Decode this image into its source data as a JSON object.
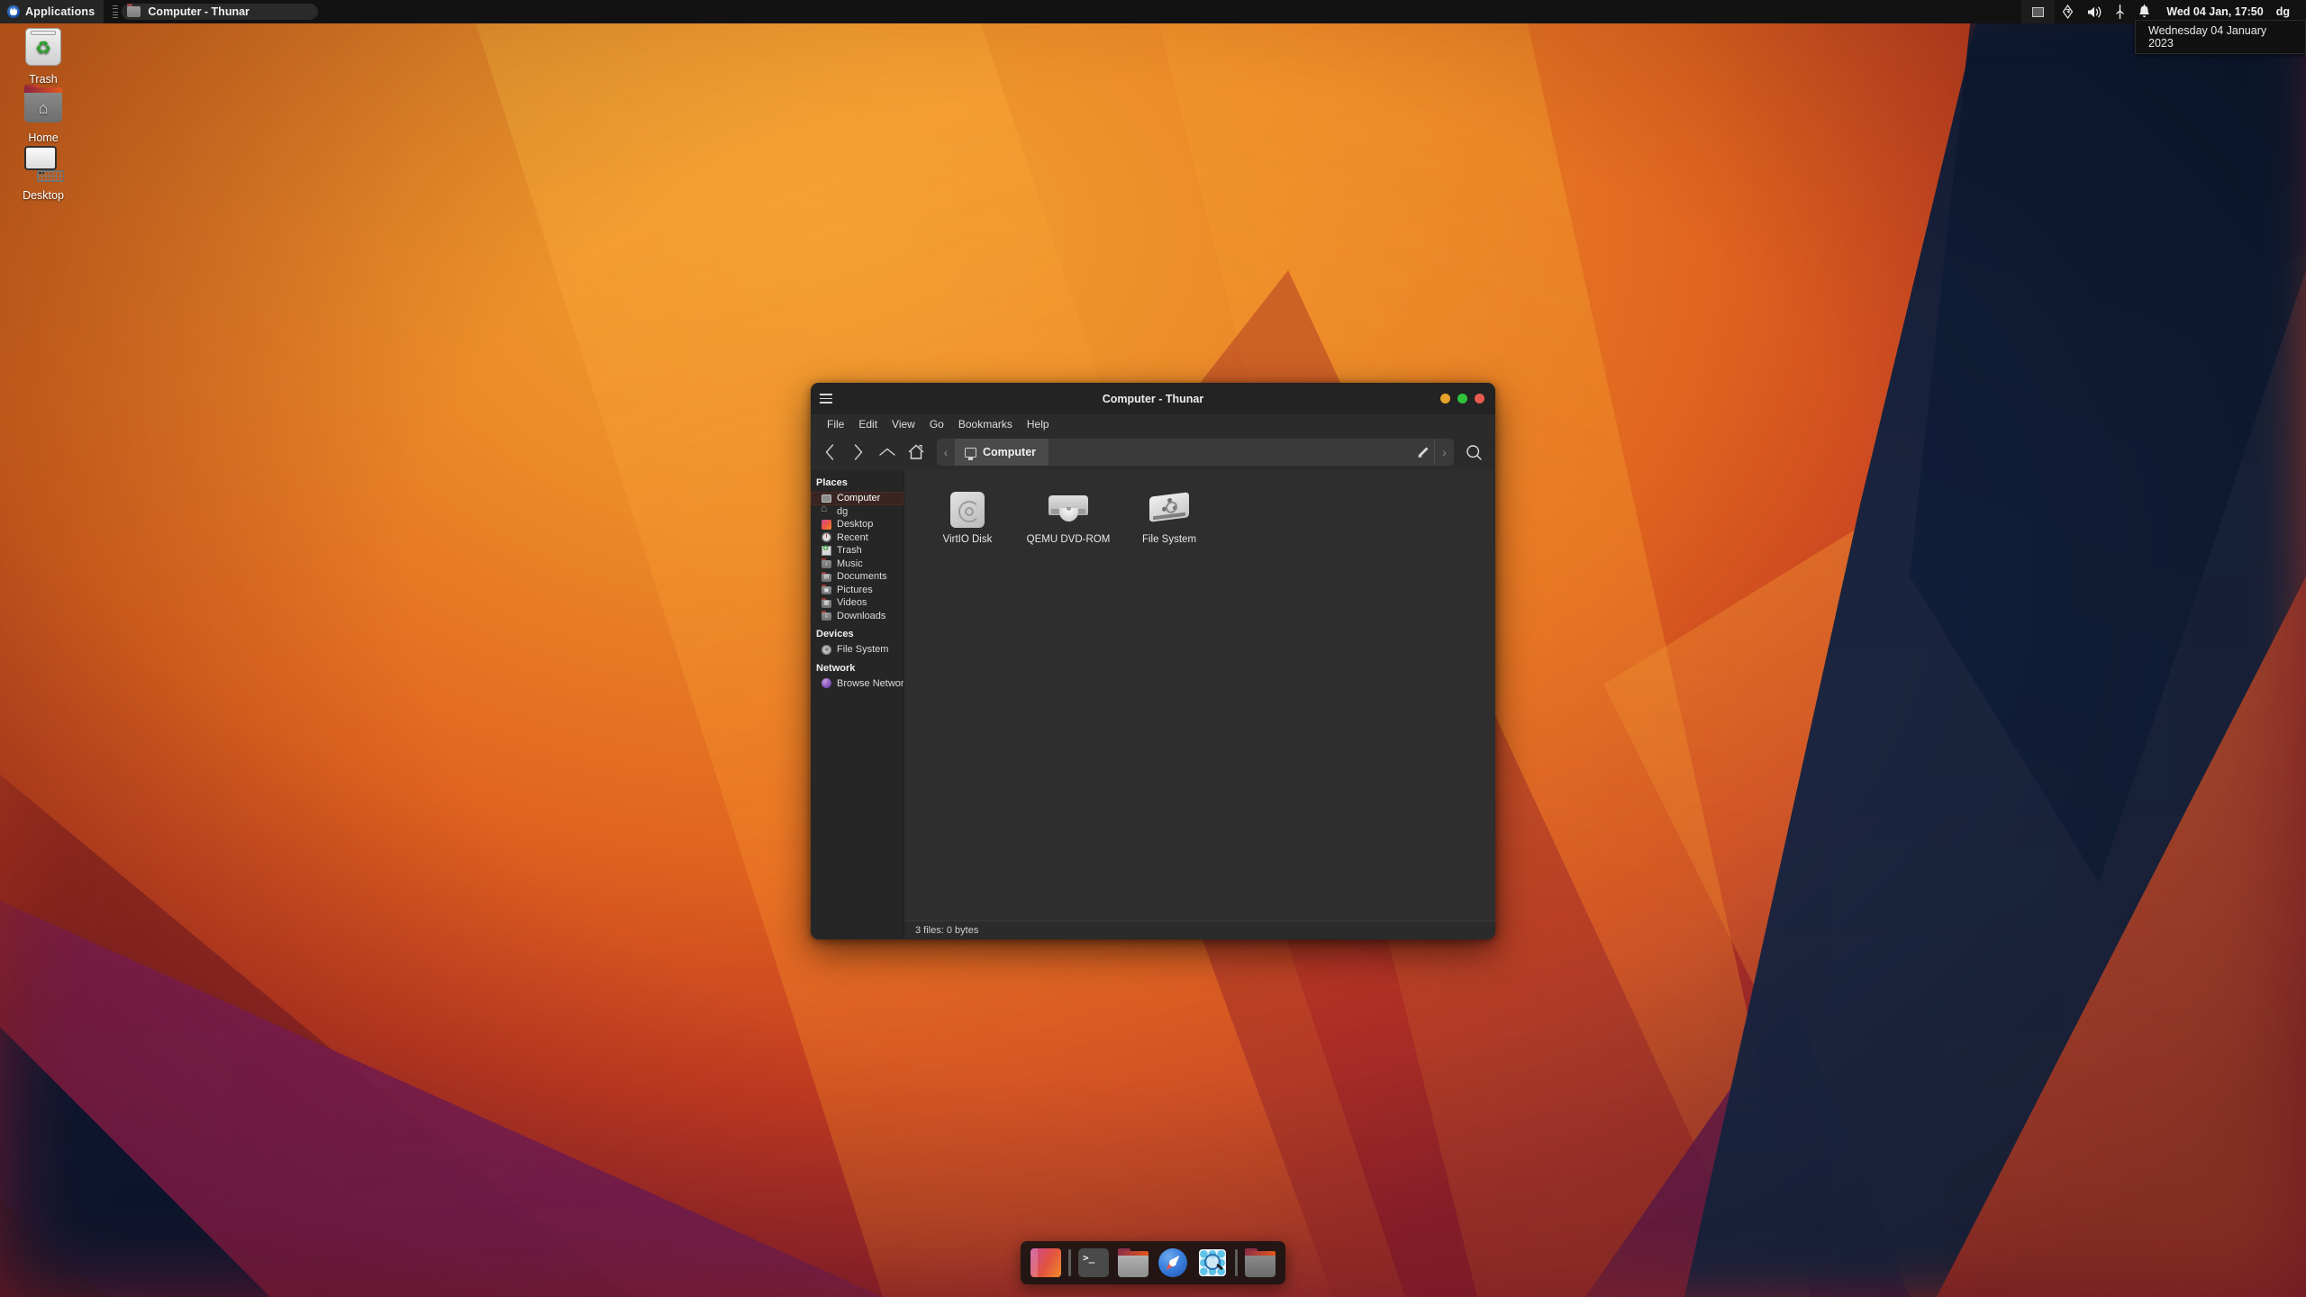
{
  "panel": {
    "applications_label": "Applications",
    "tasks": [
      {
        "label": "Computer - Thunar",
        "icon": "folder-icon",
        "active": true
      }
    ],
    "tray": {
      "show_desktop_icon": "show-desktop-icon",
      "network_icon": "network-icon",
      "volume_icon": "volume-icon",
      "power_icon": "power-icon",
      "notification_icon": "bell-icon"
    },
    "clock": "Wed 04 Jan, 17:50",
    "user": "dg",
    "tooltip": "Wednesday 04 January 2023"
  },
  "desktop": {
    "icons": [
      {
        "label": "Trash",
        "icon": "trash-icon"
      },
      {
        "label": "Home",
        "icon": "home-folder-icon"
      },
      {
        "label": "Desktop",
        "icon": "desktop-computer-icon"
      }
    ]
  },
  "window": {
    "title": "Computer - Thunar",
    "menus": [
      "File",
      "Edit",
      "View",
      "Go",
      "Bookmarks",
      "Help"
    ],
    "toolbar": {
      "back": "‹",
      "forward": "›",
      "up": "^",
      "home": "home-icon",
      "edit_path": "pencil-icon",
      "search": "search-icon"
    },
    "pathbar": {
      "current": "Computer",
      "scroll_left": "‹",
      "scroll_right": "›"
    },
    "sidebar": {
      "groups": [
        {
          "title": "Places",
          "items": [
            {
              "label": "Computer",
              "icon": "computer-icon",
              "selected": true
            },
            {
              "label": "dg",
              "icon": "home-icon",
              "selected": false
            },
            {
              "label": "Desktop",
              "icon": "desktop-icon",
              "selected": false
            },
            {
              "label": "Recent",
              "icon": "recent-clock-icon",
              "selected": false
            },
            {
              "label": "Trash",
              "icon": "trash-icon",
              "selected": false
            },
            {
              "label": "Music",
              "icon": "music-folder-icon",
              "selected": false
            },
            {
              "label": "Documents",
              "icon": "documents-folder-icon",
              "selected": false
            },
            {
              "label": "Pictures",
              "icon": "pictures-folder-icon",
              "selected": false
            },
            {
              "label": "Videos",
              "icon": "videos-folder-icon",
              "selected": false
            },
            {
              "label": "Downloads",
              "icon": "downloads-folder-icon",
              "selected": false
            }
          ]
        },
        {
          "title": "Devices",
          "items": [
            {
              "label": "File System",
              "icon": "filesystem-icon",
              "selected": false
            }
          ]
        },
        {
          "title": "Network",
          "items": [
            {
              "label": "Browse Network",
              "icon": "network-globe-icon",
              "selected": false
            }
          ]
        }
      ]
    },
    "files": [
      {
        "label": "VirtIO Disk",
        "icon": "harddisk-icon"
      },
      {
        "label": "QEMU DVD-ROM",
        "icon": "dvd-drive-icon"
      },
      {
        "label": "File System",
        "icon": "filesystem-drive-icon"
      }
    ],
    "statusbar": "3 files: 0 bytes"
  },
  "dock": {
    "items": [
      {
        "name": "show-desktop",
        "icon": "gradient-square-icon"
      },
      {
        "name": "separator-1",
        "icon": "separator"
      },
      {
        "name": "terminal",
        "icon": "terminal-icon"
      },
      {
        "name": "file-manager",
        "icon": "folder-icon"
      },
      {
        "name": "web-browser",
        "icon": "compass-globe-icon"
      },
      {
        "name": "application-finder",
        "icon": "magnifier-grid-icon"
      },
      {
        "name": "separator-2",
        "icon": "separator"
      },
      {
        "name": "file-manager-2",
        "icon": "folder-dark-icon"
      }
    ]
  },
  "colors": {
    "panel_bg": "#121212",
    "window_bg": "#2b2b2b",
    "sidebar_bg": "#262626",
    "selection": "#3a2421",
    "minimize": "#e8a32c",
    "maximize": "#2fc23b",
    "close": "#e85c50"
  }
}
